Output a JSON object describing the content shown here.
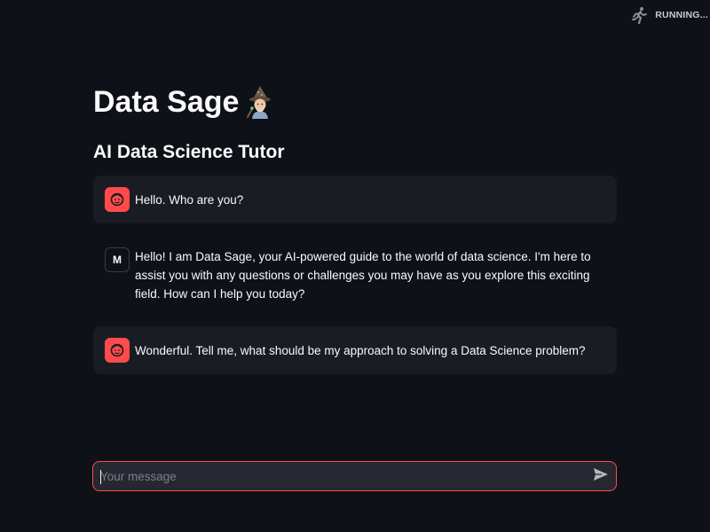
{
  "status": {
    "text": "RUNNING...",
    "icon": "running-person-icon"
  },
  "header": {
    "title": "Data Sage",
    "title_emoji": "mage-icon",
    "subtitle": "AI Data Science Tutor"
  },
  "messages": [
    {
      "role": "user",
      "avatar_icon": "user-face-icon",
      "text": "Hello. Who are you?"
    },
    {
      "role": "assistant",
      "avatar_letter": "M",
      "text": "Hello! I am Data Sage, your AI-powered guide to the world of data science. I'm here to assist you with any questions or challenges you may have as you explore this exciting field. How can I help you today?"
    },
    {
      "role": "user",
      "avatar_icon": "user-face-icon",
      "text": "Wonderful. Tell me, what should be my approach to solving a Data Science problem?"
    }
  ],
  "chat_input": {
    "placeholder": "Your message",
    "value": "",
    "send_icon": "send-icon"
  },
  "colors": {
    "background": "#0e1117",
    "user_message_bg": "#1a1c24",
    "accent": "#ff4b4b",
    "input_bg": "#262730"
  }
}
